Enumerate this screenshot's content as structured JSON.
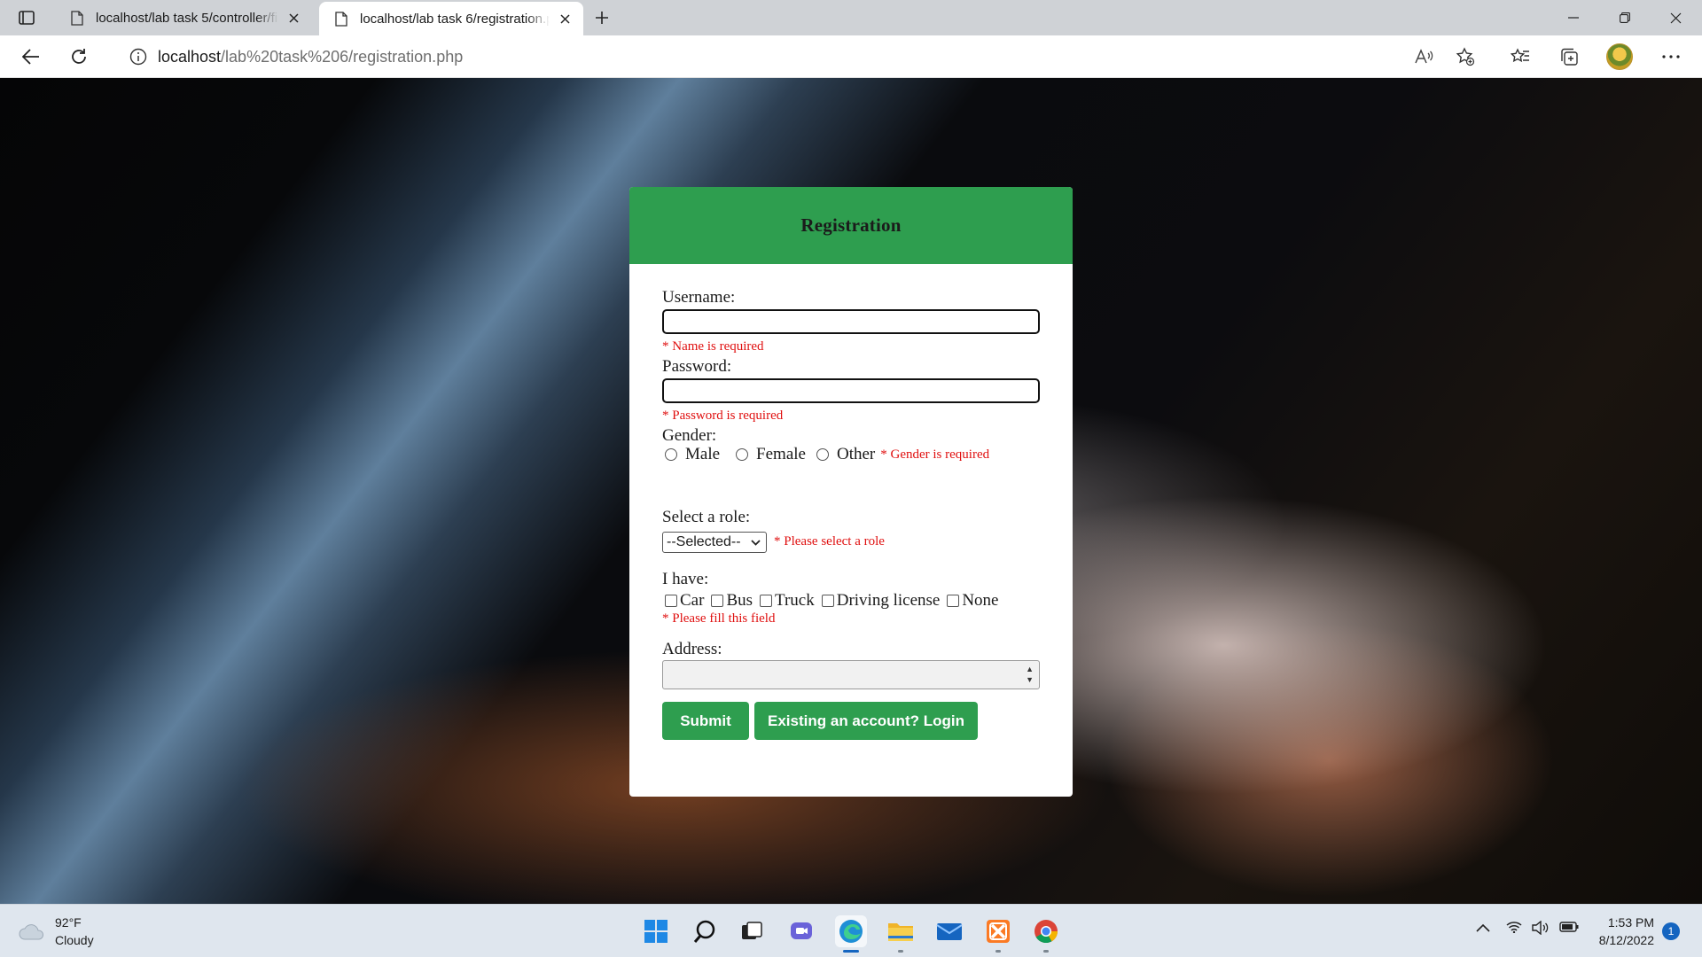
{
  "browser": {
    "tabs": [
      {
        "title": "localhost/lab task 5/controller/fin",
        "active": false
      },
      {
        "title": "localhost/lab task 6/registration.php",
        "active": true
      }
    ],
    "url": {
      "host": "localhost",
      "path": "/lab%20task%206/registration.php"
    }
  },
  "form": {
    "title": "Registration",
    "username": {
      "label": "Username:",
      "value": "",
      "error": "* Name is required"
    },
    "password": {
      "label": "Password:",
      "value": "",
      "error": "* Password is required"
    },
    "gender": {
      "label": "Gender:",
      "options": [
        "Male",
        "Female",
        "Other"
      ],
      "error": "* Gender is required"
    },
    "role": {
      "label": "Select a role:",
      "selected": "--Selected--",
      "error": "* Please select a role"
    },
    "vehicles": {
      "label": "I have:",
      "options": [
        "Car",
        "Bus",
        "Truck",
        "Driving license",
        "None"
      ],
      "error": "* Please fill this field"
    },
    "address": {
      "label": "Address:",
      "value": ""
    },
    "buttons": {
      "submit": "Submit",
      "login": "Existing an account? Login"
    }
  },
  "taskbar": {
    "weather": {
      "temp": "92°F",
      "condition": "Cloudy"
    },
    "time": "1:53 PM",
    "date": "8/12/2022",
    "notifications": "1"
  },
  "colors": {
    "accent_green": "#2e9e4f",
    "error_red": "#e01010"
  }
}
